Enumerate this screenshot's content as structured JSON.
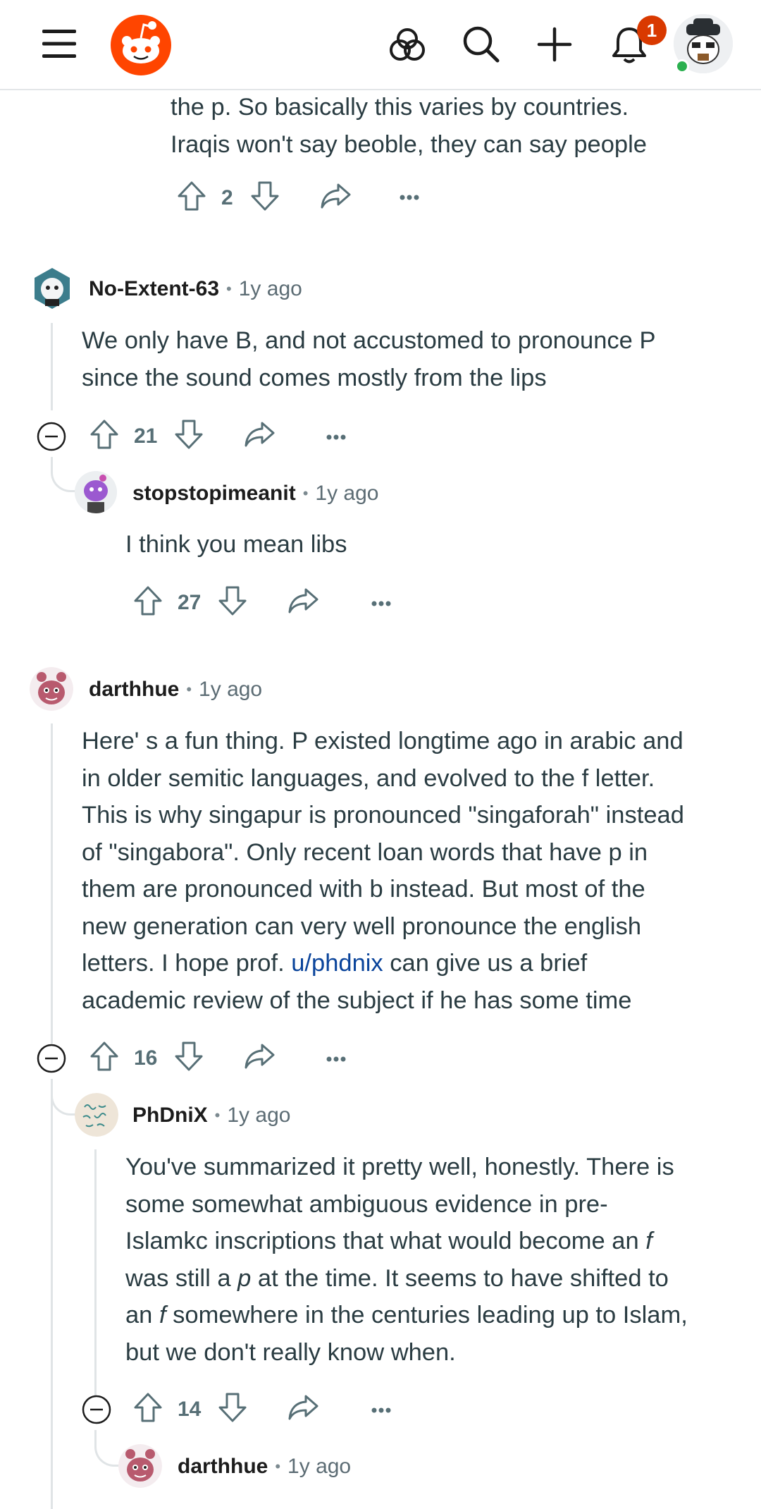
{
  "topbar": {
    "menu_icon": "hamburger-menu-icon",
    "logo_icon": "reddit-logo-icon",
    "explore_icon": "explore-icon",
    "search_icon": "search-icon",
    "create_icon": "plus-icon",
    "notifications_icon": "bell-icon",
    "notification_count": "1",
    "avatar_icon": "user-avatar-icon"
  },
  "colors": {
    "accent": "#ff4500",
    "badge": "#d93900",
    "link": "#0a449b",
    "online": "#2bb04f"
  },
  "comments": [
    {
      "body_lines": [
        "the p. So basically this varies by countries.",
        "Iraqis won't say beoble, they can say people"
      ],
      "votes": "2"
    },
    {
      "author": "No-Extent-63",
      "time": "1y ago",
      "body_lines": [
        "We only have B, and not accustomed to pronounce P",
        "since the sound comes mostly from the lips"
      ],
      "votes": "21"
    },
    {
      "author": "stopstopimeanit",
      "time": "1y ago",
      "body_lines": [
        "I think you mean libs"
      ],
      "votes": "27"
    },
    {
      "author": "darthhue",
      "time": "1y ago",
      "body_lines": [
        "Here' s a fun thing. P existed longtime ago in arabic and",
        "in older semitic languages, and evolved to the f letter.",
        "This is why singapur is pronounced \"singaforah\" instead",
        "of \"singabora\". Only recent loan words that have p in",
        "them are pronounced with b instead. But most of the",
        "new generation can very well pronounce the english",
        "letters. I hope prof. ",
        "u/phdnix",
        " can give us a brief",
        "academic review of the subject if he has some time"
      ],
      "votes": "16"
    },
    {
      "author": "PhDniX",
      "time": "1y ago",
      "body_parts": [
        "You've summarized it pretty well, honestly. There is",
        "some somewhat ambiguous evidence in pre-",
        "Islamkc inscriptions that what would become an ",
        "f",
        "was still a ",
        "p",
        " at the time. It seems to have shifted to",
        "an ",
        "f",
        " somewhere in the centuries leading up to Islam,",
        "but we don't really know when."
      ],
      "votes": "14"
    },
    {
      "author": "darthhue",
      "time": "1y ago"
    }
  ],
  "icons": {
    "upvote": "upvote-arrow-icon",
    "downvote": "downvote-arrow-icon",
    "share": "share-icon",
    "more": "more-options-icon",
    "collapse": "collapse-thread-icon"
  }
}
